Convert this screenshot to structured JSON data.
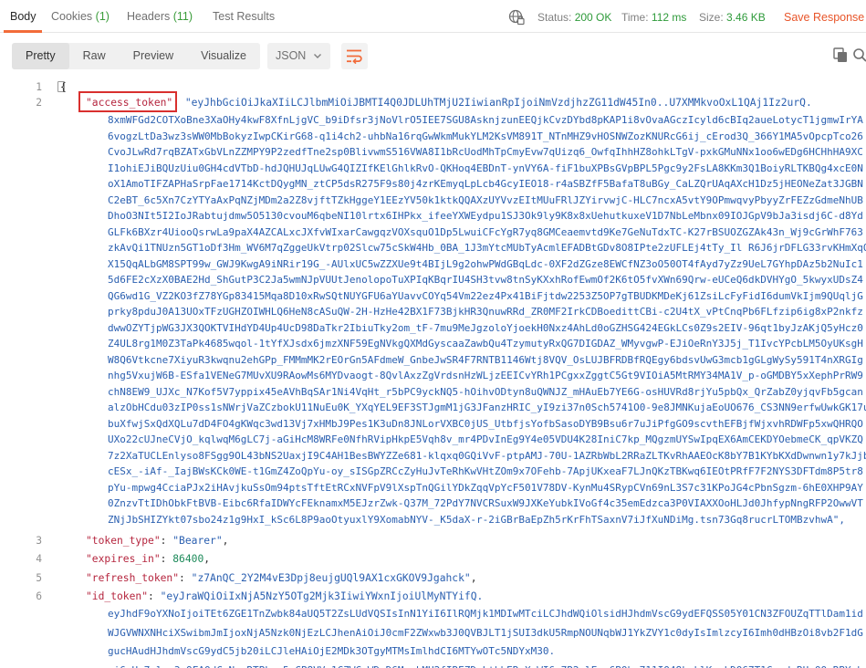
{
  "tabs": {
    "body": "Body",
    "cookies": "Cookies",
    "cookies_count": "(1)",
    "headers": "Headers",
    "headers_count": "(11)",
    "test_results": "Test Results"
  },
  "status": {
    "status_label": "Status:",
    "status_value": "200 OK",
    "time_label": "Time:",
    "time_value": "112 ms",
    "size_label": "Size:",
    "size_value": "3.46 KB",
    "save_response": "Save Response"
  },
  "view": {
    "pretty": "Pretty",
    "raw": "Raw",
    "preview": "Preview",
    "visualize": "Visualize",
    "format": "JSON"
  },
  "code": {
    "ln1": "1",
    "ln2": "2",
    "ln3": "3",
    "ln4": "4",
    "ln5": "5",
    "ln6": "6",
    "open_brace": "{",
    "access_token_key": "\"access_token\"",
    "access_token_start": "\"eyJhbGciOiJkaXIiLCJlbmMiOiJBMTI4Q0JDLUhTMjU2IiwianRpIjoiNmVzdjhzZG11dW45In0..U7XMMkvoOxL1QAj1Iz2urQ.",
    "access_token_lines": [
      "8xmWFGd2COTXoBne3XaOHy4kwF8XfnLjgVC_b9iDfsr3jNoVlrO5IEE7SGU8AsknjzunEEQjkCvzDYbd8pKAP1i8vOvaAGczIcyld6cBIq2aueLotycT1jgmwIrYA",
      "6vogzLtDa3wz3sWW0MbBokyzIwpCKirG68-q1i4ch2-uhbNa16rqGwWkmMukYLM2KsVM891T_NTnMHZ9vHOSNWZozKNURcG6ij_cErod3Q_366Y1MA5vOpcpTco26",
      "CvoJLwRd7rqBZATxGbVLnZZMPY9P2zedfTne2sp0BlivwmS516VWA8I1bRcUodMhTpCmyEvw7qUizq6_OwfqIhhHZ8ohkLTgV-pxkGMuNNx1oo6wEDg6HCHhHA9XC",
      "I1ohiEJiBQUzUiu0GH4cdVTbD-hdJQHUJqLUwG4QIZIfKElGhlkRvO-QKHoq4EBDnT-ynVY6A-fiF1buXPBsGVpBPL5Pgc9y2FsLA8KKm3Q1BoiyRLTKBQg4xcE0N",
      "oX1AmoTIFZAPHaSrpFae1714KctDQygMN_ztCP5dsR275F9s80j4zrKEmyqLpLcb4GcyIEO18-r4aSBZfF5BafaT8uBGy_CaLZQrUAqAXcH1Dz5jHEONeZat3JGBN",
      "C2eBT_6c5Xn7CzYTYaAxPqNZjMDm2a2Z8vjftTZkHggeY1EEzYV50k1ktkQQAXzUYVvzEItMUuFRlJZYirvwjC-HLC7ncxA5vtY9OPmwqvyPbyyZrFEZzGdmeNhUB",
      "DhoO3NIt5I2IoJRabtujdmw5O5130cvouM6qbeNI10lrtx6IHPkx_ifeeYXWEydpu1SJ3Ok9ly9K8x8xUehutkuxeV1D7NbLeMbnx09IOJGpV9bJa3isdj6C-d8Yd",
      "GLFk6BXzr4UiooQsrwLa9paX4AZCALxcJXfvWIxarCawgqzVOXsquO1Dp5LwuiCFcYgR7yq8GMCeaemvtd9Ke7GeNuTdxTC-K27rBSUOZGZAk43n_Wj9cGrWhF763",
      "zkAvQi1TNUzn5GT1oDf3Hm_WV6M7qZggeUkVtrp02Slcw75cSkW4Hb_0BA_1J3mYtcMUbTyAcmlEFADBtGDv8O8IPte2zUFLEj4tTy_Il R6J6jrDFLG33rvKHmXqOJ",
      "X15QqALbGM8SPT99w_GWJ9KwgA9iNRir19G_-AUlxUC5wZZXUe9t4BIjL9g2ohwPWdGBqLdc-0XF2dZGze8EWCfNZ3oO50OT4fAyd7yZz9UeL7GYhpDAz5b2NuIc1",
      "5d6FE2cXzX0BAE2Hd_ShGutP3C2Ja5wmNJpVUUtJenolopoTuXPIqKBqrIU4SH3tvw8tnSyKXxhRofEwmOf2K6tO5fvXWn69Qrw-eUCeQ6dkDVHYgO_5kwyxUDsZ4",
      "QG6wd1G_VZ2KO3fZ78YGp83415Mqa8D10xRwSQtNUYGFU6aYUavvCOYq54Vm22ez4Px41BiFjtdw2253Z5OP7gTBUDKMDeKj61ZsiLcFyFidI6dumVkIjm9QUqljG",
      "prky8pduJ0A13UOxTFzUGHZOIWHLQ6HeN8cASuQW-2H-HzHe42BX1F73BjkHR3QnuwRRd_ZR0MF2IrkCDBoedittCBi-c2U4tX_vPtCnqPb6FLfzip6ig8xP2nkfz",
      "dwwOZYTjpWG3JX3QOKTVIHdYD4Up4UcD98DaTkr2IbiuTky2om_tF-7mu9MeJgzoloYjoekH0Nxz4AhLd0oGZHSG424EGkLCs0Z9s2EIV-96qt1byJzAKjQ5yHcz0",
      "Z4UL8rg1M0Z3TaPk4685wqol-1tYfXJsdx6jmzXNF59EgNVkgQXMdGyscaaZawbQu4TzymutyRxQG7DIGDAZ_WMyvgwP-EJiOeRnY3J5j_T1IvcYPcbLM5OyUKsgH",
      "W8Q6Vtkcne7XiyuR3kwqnu2ehGPp_FMMmMK2rEOrGn5AFdmeW_GnbeJwSR4F7RNTB1146Wtj8VQV_OsLUJBFRDBfRQEgy6bdsvUwG3mcb1gGLgWySy591T4nXRGIg",
      "nhg5VxujW6B-ESfa1VENeG7MUvXU9RAowMs6MYDvaogt-8QvlAxzZgVrdsnHzWLjzEEICvYRh1PCgxxZggtC5Gt9VIOiA5MtRMY34MA1V_p-oGMDBY5xXephPrRW9",
      "chN8EW9_UJXc_N7Kof5V7yppix45eAVhBqSAr1Ni4VqHt_r5bPC9yckNQ5-hOihvODtyn8uQWNJZ_mHAuEb7YE6G-osHUVRd8rjYu5pbQx_QrZabZ0yjqvFb5gcan",
      "alzObHCdu03zIP0ss1sNWrjVaZCzbokU11NuEu0K_YXqYEL9EF3STJgmM1jG3JFanzHRIC_yI9zi37n0Sch5741O0-9e8JMNKujaEoUO676_CS3NN9erfwUwkGK17u",
      "buXfwjSxQdXQLu7dD4FO4gKWqc3wd13Vj7xHMbJ9Pes1K3uDn8JNLorVXBC0jUS_UtbfjsYofbSasoDYB9Bsu6r7uJiPfgGO9scvthEFBjfWjxvhRDWFp5xwQHRQO",
      "UXo22cUJneCVjO_kqlwqM6gLC7j-aGiHcM8WRFe0NfhRVipHkpE5Vqh8v_mr4PDvInEg9Y4e05VDU4K28IniC7kp_MQgzmUYSwIpqEX6AmCEKDYOebmeCK_qpVKZQ",
      "7z2XaTUCLEnlyso8FSgg9OL43bNS2UaxjI9C4AH1BesBWYZZe681-klqxq0GQiVvF-ptpAMJ-70U-1AZRbWbL2RRaZLTKvRhAAEOcK8bY7B1KYbKXdDwnwn1y7kJjb",
      "cESx_-iAf-_IajBWsKCk0WE-t1GmZ4ZoQpYu-oy_sISGpZRCcZyHuJvTeRhKwVHtZOm9x7OFehb-7ApjUKxeaF7LJnQKzTBKwq6IEOtPRfF7F2NYS3DFTdm8P5tr8",
      "pYu-mpwg4CciaPJx2iHAvjkuSsOm94ptsTftEtRCxNVFpV9lXspTnQGilYDkZqqVpYcF501V78DV-KynMu4SRypCVn69nL3S7c31KPoJG4cPbnSgzm-6hE0XHP9AY",
      "0ZnzvTtIDhObkFtBVB-Eibc6RfaIDWYcFEknamxM5EJzrZwk-Q37M_72PdY7NVCRSuxW9JXKeYubkIVoGf4c35emEdzca3P0VIAXXOoHLJd0JhfypNngRFP2OwwVT",
      "ZNjJbSHIZYkt07sbo24z1g9HxI_kSc6L8P9aoOtyuxlY9XomabNYV-_K5daX-r-2iGBrBaEpZh5rKrFhTSaxnV7iJfXuNDiMg.tsn73Gq8rucrLTOMBzvhwA\","
    ],
    "token_type_key": "\"token_type\"",
    "token_type_value": "\"Bearer\"",
    "expires_in_key": "\"expires_in\"",
    "expires_in_value": "86400",
    "refresh_token_key": "\"refresh_token\"",
    "refresh_token_value": "\"z7AnQC_2Y2M4vE3Dpj8eujgUQl9AX1cxGKOV9Jgahck\"",
    "id_token_key": "\"id_token\"",
    "id_token_start": "\"eyJraWQiOiIxNjA5NzY5OTg2Mjk3IiwiYWxnIjoiUlMyNTYifQ.",
    "id_token_lines": [
      "eyJhdF9oYXNoIjoiTEt6ZGE1TnZwbk84aUQ5T2ZsLUdVQSIsInN1YiI6IlRQMjk1MDIwMTciLCJhdWQiOlsidHJhdmVscG9ydEFQSS05Y01CN3ZFOUZqTTlDam1id",
      "WJGVWNXNHciXSwibmJmIjoxNjA5Nzk0NjEzLCJhenAiOiJ0cmF2ZWxwb3J0QVBJLT1jSUI3dkU5RmpNOUNqbWJ1YkZVY1c0dyIsImlzcyI6Imh0dHBzOi8vb2F1dG",
      "gucHAudHJhdmVscG9ydC5jb20iLCJleHAiOjE2MDk3OTgyMTMsImlhdCI6MTYwOTc5NDYxM30.",
      "ni6uHo7ulsw3w9FAOdCzNzuRTPkwe5vCP8VVs1CZWCmWDqD6MyakMH2fIREZDzLtbbERvXrWI6n7R2wlEem6BOb_711IO48kaklKowkDQ67T1Cn-doRUeOOyRBYnb"
    ]
  }
}
